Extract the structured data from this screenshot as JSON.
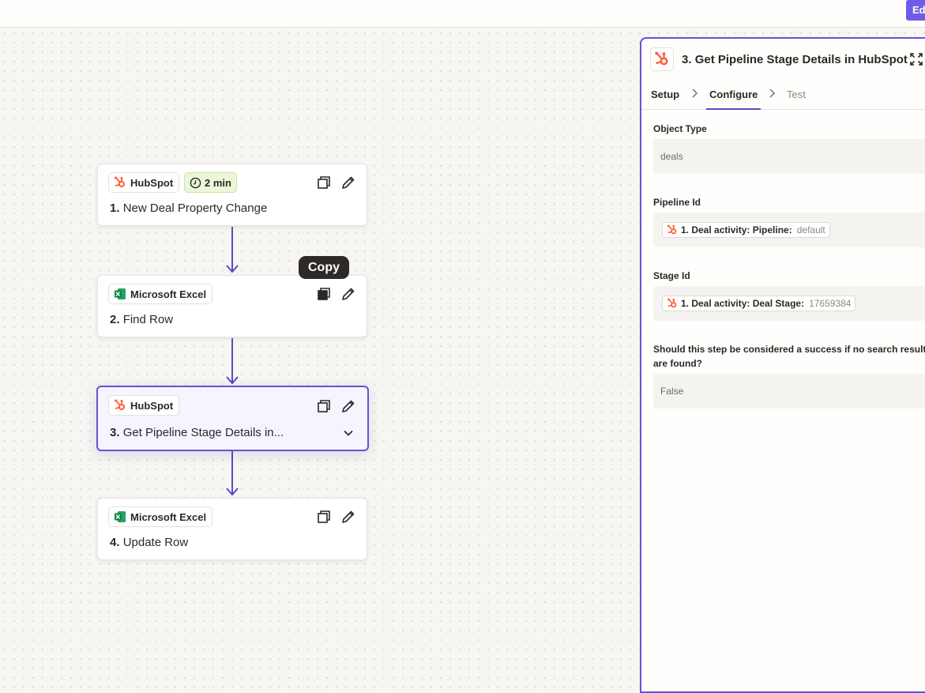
{
  "topbar": {
    "edit_label": "Edit"
  },
  "colors": {
    "accent": "#6652d9",
    "hubspot": "#ff5c35",
    "excel": "#1d7044",
    "time_badge": "#ecf6d8"
  },
  "tooltip": {
    "text": "Copy"
  },
  "steps": [
    {
      "app": "HubSpot",
      "app_icon": "hubspot-icon",
      "time": "2 min",
      "number": "1.",
      "title": "New Deal Property Change",
      "selected": false
    },
    {
      "app": "Microsoft Excel",
      "app_icon": "excel-icon",
      "number": "2.",
      "title": "Find Row",
      "selected": false
    },
    {
      "app": "HubSpot",
      "app_icon": "hubspot-icon",
      "number": "3.",
      "title": "Get Pipeline Stage Details in...",
      "selected": true
    },
    {
      "app": "Microsoft Excel",
      "app_icon": "excel-icon",
      "number": "4.",
      "title": "Update Row",
      "selected": false
    }
  ],
  "panel": {
    "number": "3.",
    "title": "Get Pipeline Stage Details in HubSpot",
    "tabs": [
      "Setup",
      "Configure",
      "Test"
    ],
    "active_tab": "Configure",
    "fields": {
      "object_type": {
        "label": "Object Type",
        "value": "deals"
      },
      "pipeline_id": {
        "label": "Pipeline Id",
        "pill_label": "1. Deal activity: Pipeline:",
        "pill_value": "default"
      },
      "stage_id": {
        "label": "Stage Id",
        "pill_label": "1. Deal activity: Deal Stage:",
        "pill_value": "17659384"
      },
      "success_if_none": {
        "label": "Should this step be considered a success if no search results are found?",
        "value": "False"
      }
    }
  }
}
